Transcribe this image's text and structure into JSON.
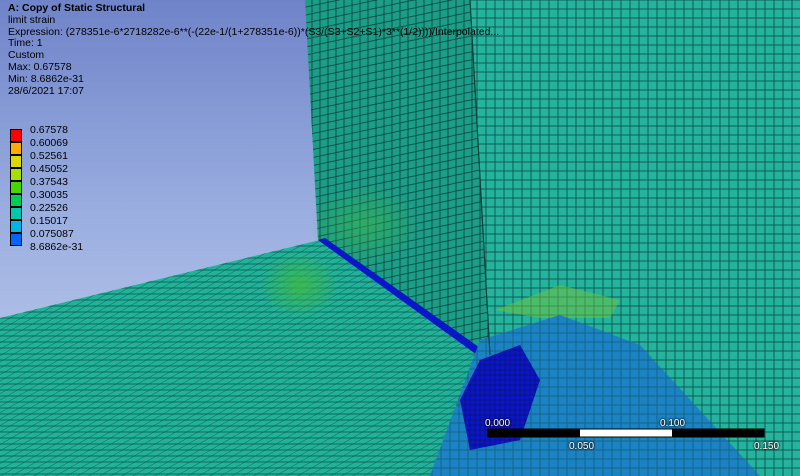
{
  "result_info": {
    "title": "A: Copy of Static Structural",
    "quantity": "limit strain",
    "expression": "Expression: (278351e-6*2718282e-6**(-(22e-1/(1+278351e-6))*(S3/(S3+S2+S1)*3**(1/2))))/Interpolated...",
    "time": "Time: 1",
    "type": "Custom",
    "max": "Max: 0.67578",
    "min": "Min: 8.6862e-31",
    "date": "28/6/2021 17:07"
  },
  "legend": {
    "labels": [
      "0.67578",
      "0.60069",
      "0.52561",
      "0.45052",
      "0.37543",
      "0.30035",
      "0.22526",
      "0.15017",
      "0.075087",
      "8.6862e-31"
    ],
    "colors": [
      "#ff0000",
      "#ffaa00",
      "#dcd800",
      "#a8df00",
      "#47d700",
      "#00cc5a",
      "#00c8a8",
      "#00b4e6",
      "#0064ff",
      "#0000dd"
    ]
  },
  "scale_bar": {
    "labels": [
      "0.000",
      "0.100",
      "0.050",
      "0.150"
    ]
  },
  "colors": {
    "mesh_teal": "#20b39a",
    "mesh_line": "#0d4a44",
    "hotspot_blue": "#0b16c9",
    "mid_blue": "#1b82c4",
    "hotspot_green": "#2fb54e"
  }
}
